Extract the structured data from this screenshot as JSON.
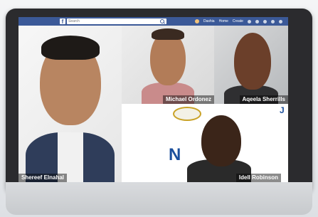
{
  "topbar": {
    "search_placeholder": "Search",
    "user_name": "Dashia",
    "home_label": "Home",
    "create_label": "Create",
    "nav_icons": [
      "friends-icon",
      "messenger-icon",
      "notifications-icon",
      "help-icon",
      "menu-chevron-icon"
    ]
  },
  "participants": [
    {
      "name": "Shereef Elnahal"
    },
    {
      "name": "Michael Ordonez"
    },
    {
      "name": "Aqeela Sherrills"
    },
    {
      "name": "Idell Robinson"
    }
  ],
  "colors": {
    "facebook_blue": "#3b5998",
    "bezel": "#2b2b2e",
    "label_bg": "rgba(0,0,0,0.45)"
  }
}
